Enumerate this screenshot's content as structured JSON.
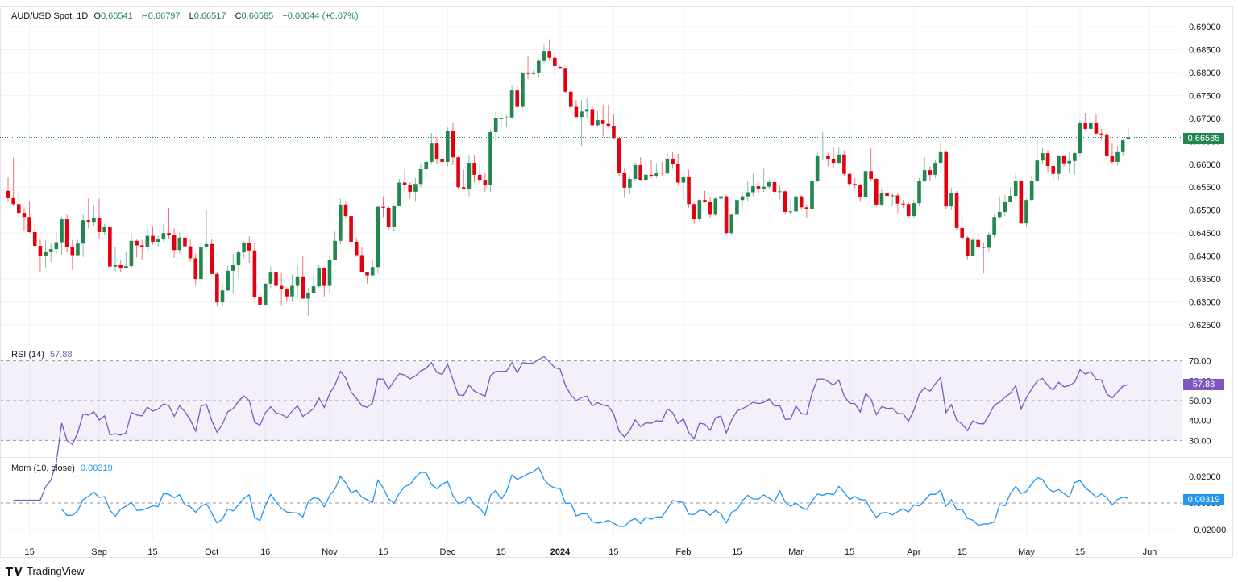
{
  "header": {
    "symbol": "AUD/USD Spot, 1D",
    "open_label": "O",
    "open": "0.66541",
    "high_label": "H",
    "high": "0.66797",
    "low_label": "L",
    "low": "0.66517",
    "close_label": "C",
    "close": "0.66585",
    "change": "+0.00044 (+0.07%)"
  },
  "rsi_panel": {
    "label": "RSI (14)",
    "value": "57.88",
    "ticks": [
      "70.00",
      "60.00",
      "50.00",
      "40.00",
      "30.00"
    ],
    "levels": [
      70,
      50,
      30
    ]
  },
  "mom_panel": {
    "label": "Mom (10, close)",
    "value": "0.00319",
    "ticks": [
      "0.02000",
      "0.00000",
      "−0.02000"
    ]
  },
  "current_price_label": "0.66585",
  "brand": "TradingView",
  "colors": {
    "up": "#22874f",
    "down": "#e3000f",
    "rsi": "#7e57c2",
    "mom": "#2196f3",
    "price_badge": "#22874f"
  },
  "chart_data": {
    "type": "candlestick",
    "title": "AUD/USD Spot, 1D",
    "ylim": [
      0.622,
      0.692
    ],
    "y_ticks": [
      "0.69000",
      "0.68500",
      "0.68000",
      "0.67500",
      "0.67000",
      "0.66500",
      "0.66000",
      "0.65500",
      "0.65000",
      "0.64500",
      "0.64000",
      "0.63500",
      "0.63000",
      "0.62500"
    ],
    "x_ticks": [
      "15",
      "Sep",
      "15",
      "Oct",
      "16",
      "Nov",
      "15",
      "Dec",
      "15",
      "2024",
      "15",
      "Feb",
      "15",
      "Mar",
      "15",
      "Apr",
      "15",
      "May",
      "15",
      "Jun"
    ],
    "grid": true,
    "indicators": [
      "RSI (14)",
      "Mom (10, close)"
    ],
    "candles_ohlc": [
      [
        0.6542,
        0.6571,
        0.6519,
        0.6526
      ],
      [
        0.6526,
        0.6615,
        0.651,
        0.6513
      ],
      [
        0.6513,
        0.654,
        0.6483,
        0.6494
      ],
      [
        0.6494,
        0.6505,
        0.6454,
        0.6485
      ],
      [
        0.6485,
        0.652,
        0.645,
        0.6452
      ],
      [
        0.6452,
        0.6471,
        0.6419,
        0.6422
      ],
      [
        0.6422,
        0.6437,
        0.6364,
        0.6401
      ],
      [
        0.6401,
        0.6434,
        0.6375,
        0.641
      ],
      [
        0.641,
        0.6427,
        0.6387,
        0.6415
      ],
      [
        0.6415,
        0.6452,
        0.6404,
        0.643
      ],
      [
        0.643,
        0.6486,
        0.6403,
        0.648
      ],
      [
        0.648,
        0.649,
        0.6408,
        0.642
      ],
      [
        0.642,
        0.6435,
        0.637,
        0.6402
      ],
      [
        0.6402,
        0.6435,
        0.64,
        0.6427
      ],
      [
        0.6427,
        0.6491,
        0.6398,
        0.6478
      ],
      [
        0.6478,
        0.6525,
        0.646,
        0.6473
      ],
      [
        0.6473,
        0.6511,
        0.6466,
        0.6483
      ],
      [
        0.6483,
        0.6525,
        0.6436,
        0.6452
      ],
      [
        0.6452,
        0.647,
        0.6445,
        0.6463
      ],
      [
        0.6463,
        0.6468,
        0.6367,
        0.6377
      ],
      [
        0.6377,
        0.642,
        0.6367,
        0.638
      ],
      [
        0.638,
        0.639,
        0.6364,
        0.6373
      ],
      [
        0.6373,
        0.641,
        0.6372,
        0.6378
      ],
      [
        0.6378,
        0.645,
        0.6375,
        0.6433
      ],
      [
        0.6433,
        0.6436,
        0.6397,
        0.6423
      ],
      [
        0.6423,
        0.6435,
        0.6392,
        0.642
      ],
      [
        0.642,
        0.6463,
        0.641,
        0.6444
      ],
      [
        0.6444,
        0.6465,
        0.6425,
        0.6431
      ],
      [
        0.6431,
        0.6445,
        0.6419,
        0.6436
      ],
      [
        0.6436,
        0.647,
        0.6431,
        0.645
      ],
      [
        0.645,
        0.6505,
        0.6438,
        0.6445
      ],
      [
        0.6445,
        0.646,
        0.6396,
        0.6413
      ],
      [
        0.6413,
        0.6451,
        0.6405,
        0.644
      ],
      [
        0.644,
        0.645,
        0.641,
        0.6421
      ],
      [
        0.6421,
        0.6435,
        0.6387,
        0.6395
      ],
      [
        0.6395,
        0.6405,
        0.6335,
        0.635
      ],
      [
        0.635,
        0.643,
        0.6345,
        0.642
      ],
      [
        0.642,
        0.65,
        0.6414,
        0.6426
      ],
      [
        0.6426,
        0.6436,
        0.636,
        0.6361
      ],
      [
        0.6361,
        0.6365,
        0.629,
        0.6299
      ],
      [
        0.6299,
        0.634,
        0.629,
        0.6325
      ],
      [
        0.6325,
        0.6378,
        0.6323,
        0.6368
      ],
      [
        0.6368,
        0.6405,
        0.6317,
        0.638
      ],
      [
        0.638,
        0.6413,
        0.635,
        0.6408
      ],
      [
        0.6408,
        0.6433,
        0.6395,
        0.6429
      ],
      [
        0.6429,
        0.6443,
        0.6385,
        0.6412
      ],
      [
        0.6412,
        0.6429,
        0.6305,
        0.6311
      ],
      [
        0.6311,
        0.633,
        0.6283,
        0.6294
      ],
      [
        0.6294,
        0.634,
        0.6293,
        0.634
      ],
      [
        0.634,
        0.6377,
        0.633,
        0.6364
      ],
      [
        0.6364,
        0.639,
        0.6325,
        0.6335
      ],
      [
        0.6335,
        0.6363,
        0.6293,
        0.6328
      ],
      [
        0.6328,
        0.6332,
        0.63,
        0.6312
      ],
      [
        0.6312,
        0.636,
        0.63,
        0.6335
      ],
      [
        0.6335,
        0.638,
        0.631,
        0.6354
      ],
      [
        0.6354,
        0.64,
        0.6307,
        0.6307
      ],
      [
        0.6307,
        0.633,
        0.627,
        0.632
      ],
      [
        0.632,
        0.636,
        0.6318,
        0.6334
      ],
      [
        0.6334,
        0.638,
        0.633,
        0.6373
      ],
      [
        0.6373,
        0.6376,
        0.6312,
        0.6335
      ],
      [
        0.6335,
        0.64,
        0.632,
        0.6392
      ],
      [
        0.6392,
        0.6453,
        0.639,
        0.6433
      ],
      [
        0.6433,
        0.6525,
        0.6425,
        0.6512
      ],
      [
        0.6512,
        0.652,
        0.6483,
        0.6487
      ],
      [
        0.6487,
        0.65,
        0.6415,
        0.6431
      ],
      [
        0.6431,
        0.644,
        0.6398,
        0.6402
      ],
      [
        0.6402,
        0.642,
        0.6365,
        0.6365
      ],
      [
        0.6365,
        0.6365,
        0.634,
        0.6358
      ],
      [
        0.6358,
        0.639,
        0.6356,
        0.6376
      ],
      [
        0.6376,
        0.651,
        0.6362,
        0.6507
      ],
      [
        0.6507,
        0.653,
        0.6485,
        0.6505
      ],
      [
        0.6505,
        0.651,
        0.6457,
        0.6463
      ],
      [
        0.6463,
        0.6512,
        0.6455,
        0.651
      ],
      [
        0.651,
        0.6568,
        0.6508,
        0.656
      ],
      [
        0.656,
        0.6589,
        0.6538,
        0.6555
      ],
      [
        0.6555,
        0.656,
        0.6525,
        0.654
      ],
      [
        0.654,
        0.657,
        0.652,
        0.6557
      ],
      [
        0.6557,
        0.66,
        0.655,
        0.6589
      ],
      [
        0.6589,
        0.661,
        0.6575,
        0.6605
      ],
      [
        0.6605,
        0.6668,
        0.66,
        0.6645
      ],
      [
        0.6645,
        0.666,
        0.66,
        0.6612
      ],
      [
        0.6612,
        0.664,
        0.6572,
        0.6605
      ],
      [
        0.6605,
        0.668,
        0.6595,
        0.6672
      ],
      [
        0.6672,
        0.669,
        0.6598,
        0.6615
      ],
      [
        0.6615,
        0.6617,
        0.6545,
        0.655
      ],
      [
        0.655,
        0.6588,
        0.6545,
        0.6547
      ],
      [
        0.6547,
        0.662,
        0.653,
        0.6603
      ],
      [
        0.6603,
        0.662,
        0.656,
        0.6577
      ],
      [
        0.6577,
        0.66,
        0.6555,
        0.6566
      ],
      [
        0.6566,
        0.658,
        0.654,
        0.6555
      ],
      [
        0.6555,
        0.6675,
        0.654,
        0.667
      ],
      [
        0.667,
        0.6715,
        0.665,
        0.67
      ],
      [
        0.67,
        0.671,
        0.668,
        0.67
      ],
      [
        0.67,
        0.6707,
        0.668,
        0.6702
      ],
      [
        0.6702,
        0.6773,
        0.67,
        0.6761
      ],
      [
        0.6761,
        0.677,
        0.672,
        0.6725
      ],
      [
        0.6725,
        0.68,
        0.6722,
        0.68
      ],
      [
        0.68,
        0.6835,
        0.6785,
        0.6797
      ],
      [
        0.6797,
        0.6805,
        0.6795,
        0.68
      ],
      [
        0.68,
        0.683,
        0.679,
        0.6825
      ],
      [
        0.6825,
        0.686,
        0.682,
        0.6847
      ],
      [
        0.6847,
        0.6871,
        0.6825,
        0.6832
      ],
      [
        0.6832,
        0.6845,
        0.6795,
        0.6814
      ],
      [
        0.6812,
        0.6815,
        0.6808,
        0.681
      ],
      [
        0.681,
        0.681,
        0.6755,
        0.6758
      ],
      [
        0.6758,
        0.6765,
        0.672,
        0.6725
      ],
      [
        0.6725,
        0.674,
        0.67,
        0.6703
      ],
      [
        0.6703,
        0.674,
        0.664,
        0.6715
      ],
      [
        0.6715,
        0.6745,
        0.67,
        0.672
      ],
      [
        0.672,
        0.6727,
        0.6683,
        0.6685
      ],
      [
        0.6685,
        0.6715,
        0.6683,
        0.6696
      ],
      [
        0.6696,
        0.673,
        0.666,
        0.6688
      ],
      [
        0.6688,
        0.673,
        0.668,
        0.6684
      ],
      [
        0.6684,
        0.671,
        0.6655,
        0.6657
      ],
      [
        0.6657,
        0.666,
        0.6575,
        0.6582
      ],
      [
        0.6582,
        0.659,
        0.6527,
        0.6549
      ],
      [
        0.6549,
        0.6572,
        0.6535,
        0.6568
      ],
      [
        0.6568,
        0.6605,
        0.6565,
        0.6598
      ],
      [
        0.6598,
        0.6615,
        0.6563,
        0.6566
      ],
      [
        0.6566,
        0.66,
        0.6557,
        0.6577
      ],
      [
        0.6577,
        0.6608,
        0.657,
        0.6575
      ],
      [
        0.6575,
        0.6602,
        0.657,
        0.6582
      ],
      [
        0.6582,
        0.6605,
        0.6575,
        0.658
      ],
      [
        0.658,
        0.6625,
        0.6578,
        0.6612
      ],
      [
        0.6612,
        0.6627,
        0.659,
        0.66
      ],
      [
        0.66,
        0.6623,
        0.6553,
        0.656
      ],
      [
        0.656,
        0.658,
        0.6523,
        0.6572
      ],
      [
        0.6572,
        0.6588,
        0.6505,
        0.6513
      ],
      [
        0.6513,
        0.6518,
        0.647,
        0.648
      ],
      [
        0.648,
        0.6525,
        0.6476,
        0.6522
      ],
      [
        0.6522,
        0.6542,
        0.6516,
        0.6518
      ],
      [
        0.6518,
        0.6528,
        0.6483,
        0.649
      ],
      [
        0.649,
        0.653,
        0.6487,
        0.6525
      ],
      [
        0.6525,
        0.654,
        0.6518,
        0.653
      ],
      [
        0.653,
        0.6533,
        0.6445,
        0.645
      ],
      [
        0.645,
        0.6492,
        0.6445,
        0.649
      ],
      [
        0.649,
        0.653,
        0.6475,
        0.6522
      ],
      [
        0.6522,
        0.654,
        0.6507,
        0.653
      ],
      [
        0.653,
        0.6565,
        0.652,
        0.6539
      ],
      [
        0.6539,
        0.658,
        0.653,
        0.6552
      ],
      [
        0.6552,
        0.656,
        0.6538,
        0.6547
      ],
      [
        0.6547,
        0.659,
        0.654,
        0.6551
      ],
      [
        0.6551,
        0.6566,
        0.6547,
        0.6561
      ],
      [
        0.6561,
        0.6562,
        0.6535,
        0.654
      ],
      [
        0.654,
        0.6554,
        0.6523,
        0.6541
      ],
      [
        0.6541,
        0.6543,
        0.649,
        0.6496
      ],
      [
        0.6496,
        0.6525,
        0.649,
        0.6497
      ],
      [
        0.6497,
        0.6537,
        0.6496,
        0.653
      ],
      [
        0.653,
        0.6532,
        0.6502,
        0.6506
      ],
      [
        0.6506,
        0.6512,
        0.6482,
        0.6503
      ],
      [
        0.6503,
        0.658,
        0.6495,
        0.6563
      ],
      [
        0.6563,
        0.6625,
        0.656,
        0.6618
      ],
      [
        0.6618,
        0.667,
        0.661,
        0.6619
      ],
      [
        0.6619,
        0.6625,
        0.6595,
        0.6612
      ],
      [
        0.6612,
        0.6638,
        0.659,
        0.6603
      ],
      [
        0.6603,
        0.6638,
        0.66,
        0.6621
      ],
      [
        0.6621,
        0.663,
        0.6575,
        0.6579
      ],
      [
        0.6579,
        0.6582,
        0.6553,
        0.6557
      ],
      [
        0.6557,
        0.657,
        0.6548,
        0.6555
      ],
      [
        0.6555,
        0.6557,
        0.652,
        0.6529
      ],
      [
        0.6529,
        0.6585,
        0.6528,
        0.6585
      ],
      [
        0.6585,
        0.6635,
        0.6562,
        0.6568
      ],
      [
        0.6568,
        0.657,
        0.651,
        0.6512
      ],
      [
        0.6512,
        0.6545,
        0.6508,
        0.6538
      ],
      [
        0.6538,
        0.656,
        0.653,
        0.6531
      ],
      [
        0.6531,
        0.6537,
        0.651,
        0.6532
      ],
      [
        0.6532,
        0.6537,
        0.6494,
        0.6514
      ],
      [
        0.6514,
        0.6522,
        0.6505,
        0.6513
      ],
      [
        0.6513,
        0.6517,
        0.6482,
        0.6487
      ],
      [
        0.6487,
        0.6522,
        0.6484,
        0.6515
      ],
      [
        0.6515,
        0.657,
        0.6508,
        0.6564
      ],
      [
        0.6564,
        0.6615,
        0.6561,
        0.6587
      ],
      [
        0.6587,
        0.6595,
        0.6564,
        0.6577
      ],
      [
        0.6577,
        0.661,
        0.657,
        0.6603
      ],
      [
        0.6603,
        0.6645,
        0.6602,
        0.6628
      ],
      [
        0.6628,
        0.663,
        0.6503,
        0.6508
      ],
      [
        0.6508,
        0.6548,
        0.65,
        0.6538
      ],
      [
        0.6538,
        0.6542,
        0.6457,
        0.6461
      ],
      [
        0.6461,
        0.6482,
        0.6432,
        0.644
      ],
      [
        0.644,
        0.6443,
        0.6393,
        0.64
      ],
      [
        0.64,
        0.644,
        0.6402,
        0.6435
      ],
      [
        0.6435,
        0.645,
        0.6413,
        0.642
      ],
      [
        0.642,
        0.643,
        0.6362,
        0.6418
      ],
      [
        0.6418,
        0.6452,
        0.641,
        0.6447
      ],
      [
        0.6447,
        0.649,
        0.644,
        0.6485
      ],
      [
        0.6485,
        0.653,
        0.648,
        0.6496
      ],
      [
        0.6496,
        0.6533,
        0.6487,
        0.6517
      ],
      [
        0.6517,
        0.655,
        0.652,
        0.6531
      ],
      [
        0.6531,
        0.658,
        0.6524,
        0.6564
      ],
      [
        0.6564,
        0.6565,
        0.647,
        0.6471
      ],
      [
        0.6471,
        0.6525,
        0.6465,
        0.6522
      ],
      [
        0.6522,
        0.6575,
        0.652,
        0.6564
      ],
      [
        0.6564,
        0.6651,
        0.656,
        0.6608
      ],
      [
        0.6608,
        0.6635,
        0.66,
        0.6624
      ],
      [
        0.6624,
        0.663,
        0.6583,
        0.6596
      ],
      [
        0.6596,
        0.659,
        0.6565,
        0.6579
      ],
      [
        0.6579,
        0.662,
        0.6567,
        0.6619
      ],
      [
        0.6619,
        0.662,
        0.6595,
        0.6602
      ],
      [
        0.6602,
        0.6628,
        0.6582,
        0.6607
      ],
      [
        0.6607,
        0.6627,
        0.6578,
        0.6624
      ],
      [
        0.6624,
        0.6695,
        0.6618,
        0.6691
      ],
      [
        0.6691,
        0.6712,
        0.6674,
        0.6677
      ],
      [
        0.6677,
        0.67,
        0.6663,
        0.6691
      ],
      [
        0.6691,
        0.671,
        0.6665,
        0.6667
      ],
      [
        0.6667,
        0.6677,
        0.6653,
        0.6665
      ],
      [
        0.6665,
        0.667,
        0.6615,
        0.6619
      ],
      [
        0.6619,
        0.6645,
        0.66,
        0.6605
      ],
      [
        0.6605,
        0.664,
        0.6597,
        0.6628
      ],
      [
        0.6628,
        0.6655,
        0.6619,
        0.6652
      ],
      [
        0.66541,
        0.66797,
        0.66517,
        0.66585
      ]
    ]
  }
}
